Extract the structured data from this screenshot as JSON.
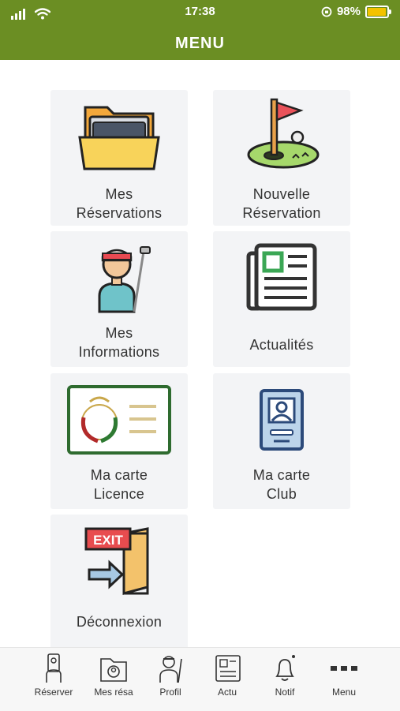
{
  "status": {
    "time": "17:38",
    "battery": "98%"
  },
  "header": {
    "title": "MENU"
  },
  "tiles": [
    {
      "line1": "Mes",
      "line2": "Réservations",
      "icon": "folder-icon"
    },
    {
      "line1": "Nouvelle",
      "line2": "Réservation",
      "icon": "golf-flag-icon"
    },
    {
      "line1": "Mes",
      "line2": "Informations",
      "icon": "golfer-icon"
    },
    {
      "line1": "Actualités",
      "icon": "newspaper-icon"
    },
    {
      "line1": "Ma carte",
      "line2": "Licence",
      "icon": "license-card-icon"
    },
    {
      "line1": "Ma carte",
      "line2": "Club",
      "icon": "club-card-icon"
    },
    {
      "line1": "Déconnexion",
      "icon": "exit-icon",
      "exit_sign": "EXIT"
    }
  ],
  "tabs": [
    {
      "label": "Réserver",
      "icon": "reserve-icon"
    },
    {
      "label": "Mes résa",
      "icon": "bookings-icon"
    },
    {
      "label": "Profil",
      "icon": "profile-icon"
    },
    {
      "label": "Actu",
      "icon": "news-icon"
    },
    {
      "label": "Notif",
      "icon": "bell-icon"
    },
    {
      "label": "Menu",
      "icon": "more-icon"
    }
  ],
  "colors": {
    "header": "#6b8e23",
    "tile_bg": "#f3f4f6"
  }
}
